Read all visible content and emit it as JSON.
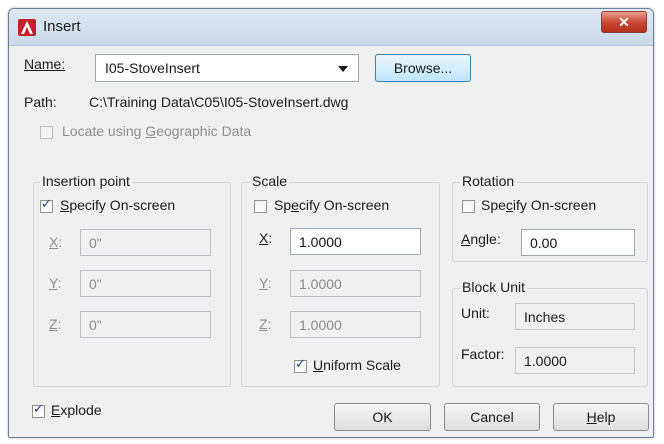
{
  "window": {
    "title": "Insert"
  },
  "name_row": {
    "label": "Name:",
    "value": "I05-StoveInsert",
    "browse_label": "Browse..."
  },
  "path_row": {
    "label": "Path:",
    "value": "C:\\Training Data\\C05\\I05-StoveInsert.dwg"
  },
  "geo": {
    "label_pre": "Locate using ",
    "label_key": "G",
    "label_post": "eographic Data",
    "checked": false
  },
  "insertion_point": {
    "legend": "Insertion point",
    "specify_pre": "",
    "specify_key": "S",
    "specify_post": "pecify On-screen",
    "specify_checked": true,
    "x_key": "X",
    "x_colon": ":",
    "x_value": "0\"",
    "y_key": "Y",
    "y_colon": ":",
    "y_value": "0\"",
    "z_key": "Z",
    "z_colon": ":",
    "z_value": "0\""
  },
  "scale": {
    "legend": "Scale",
    "specify_pre": "Sp",
    "specify_key": "e",
    "specify_post": "cify On-screen",
    "specify_checked": false,
    "x_key": "X",
    "x_colon": ":",
    "x_value": "1.0000",
    "y_key": "Y",
    "y_colon": ":",
    "y_value": "1.0000",
    "z_key": "Z",
    "z_colon": ":",
    "z_value": "1.0000",
    "uniform_pre": "",
    "uniform_key": "U",
    "uniform_post": "niform Scale",
    "uniform_checked": true
  },
  "rotation": {
    "legend": "Rotation",
    "specify_pre": "Spe",
    "specify_key": "c",
    "specify_post": "ify On-screen",
    "specify_checked": false,
    "angle_key": "A",
    "angle_post": "ngle:",
    "angle_value": "0.00"
  },
  "block_unit": {
    "legend": "Block Unit",
    "unit_label": "Unit:",
    "unit_value": "Inches",
    "factor_label": "Factor:",
    "factor_value": "1.0000"
  },
  "explode": {
    "key": "E",
    "post": "xplode",
    "checked": true
  },
  "buttons": {
    "ok": "OK",
    "cancel": "Cancel",
    "help_key": "H",
    "help_post": "elp"
  },
  "colors": {
    "title_bar": "#c9d9ea",
    "close_button": "#c7432f",
    "dialog_bg": "#f0f0f0",
    "focus_border": "#3c7fb1"
  }
}
